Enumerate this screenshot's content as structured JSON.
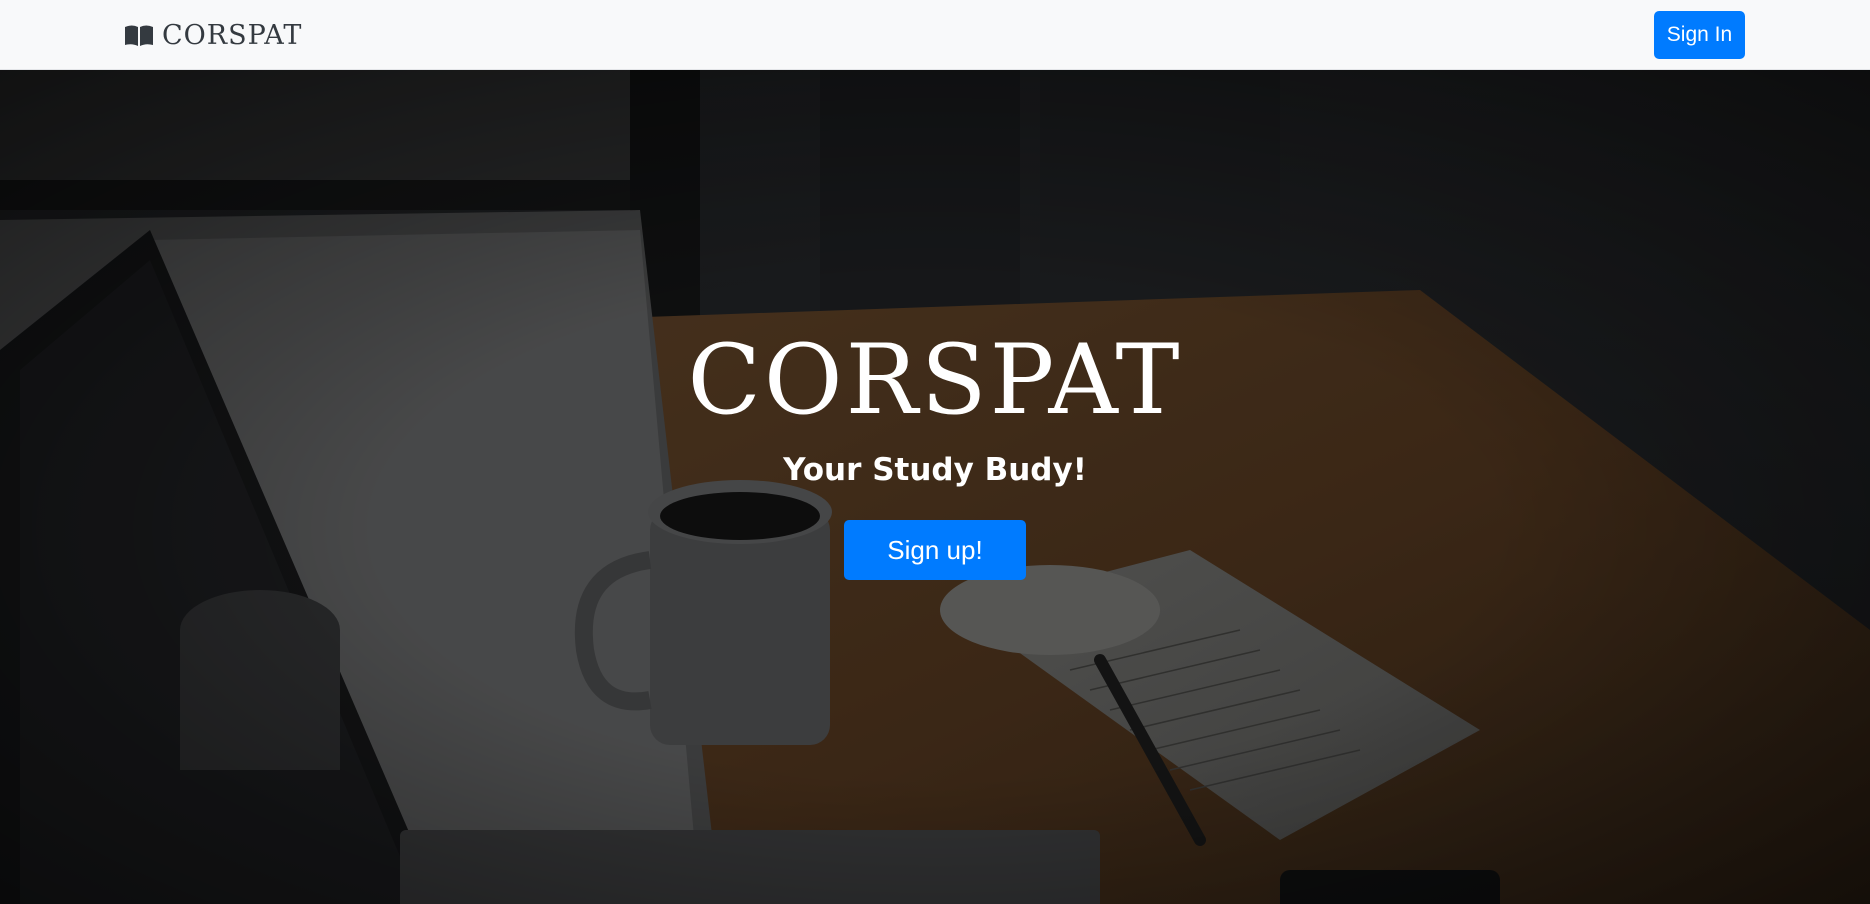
{
  "navbar": {
    "brand_icon": "open-book-icon",
    "brand_name": "CORSPAT",
    "signin_label": "Sign In",
    "background_color": "#f8f9fa"
  },
  "hero": {
    "title": "CORSPAT",
    "subtitle": "Your Study Budy!",
    "signup_label": "Sign up!",
    "background_image": "dark desk photo with laptop, coffee mug, notepad and pen"
  },
  "colors": {
    "primary": "#007bff",
    "brand_text": "#343a40",
    "hero_text": "#ffffff"
  }
}
